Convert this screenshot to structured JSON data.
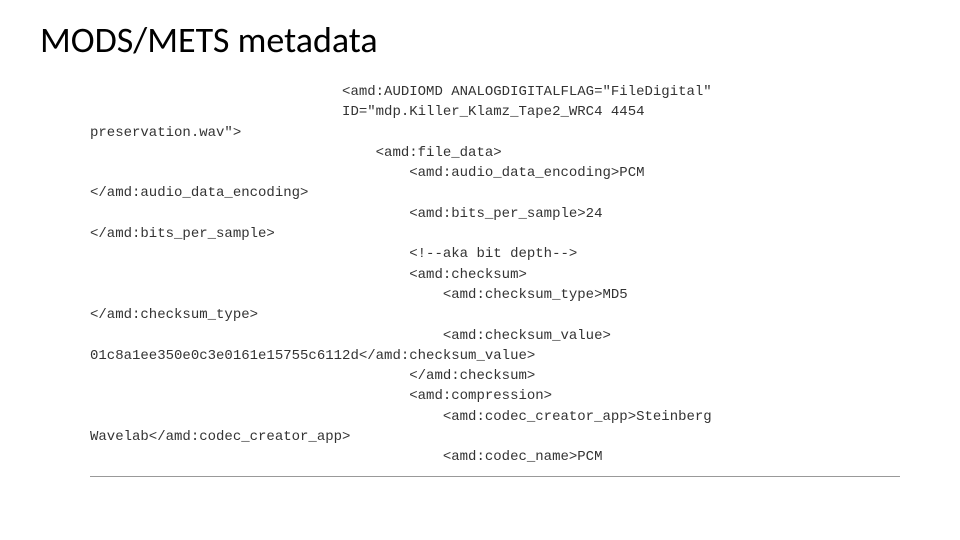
{
  "title": "MODS/METS metadata",
  "lines": [
    "                              <amd:AUDIOMD ANALOGDIGITALFLAG=\"FileDigital\"",
    "                              ID=\"mdp.Killer_Klamz_Tape2_WRC4 4454",
    "preservation.wav\">",
    "                                  <amd:file_data>",
    "                                      <amd:audio_data_encoding>PCM",
    "</amd:audio_data_encoding>",
    "                                      <amd:bits_per_sample>24",
    "</amd:bits_per_sample>",
    "",
    "                                      <!--aka bit depth-->",
    "                                      <amd:checksum>",
    "                                          <amd:checksum_type>MD5",
    "</amd:checksum_type>",
    "",
    "                                          <amd:checksum_value>",
    "01c8a1ee350e0c3e0161e15755c6112d</amd:checksum_value>",
    "                                      </amd:checksum>",
    "                                      <amd:compression>",
    "                                          <amd:codec_creator_app>Steinberg",
    "Wavelab</amd:codec_creator_app>",
    "                                          <amd:codec_name>PCM"
  ]
}
